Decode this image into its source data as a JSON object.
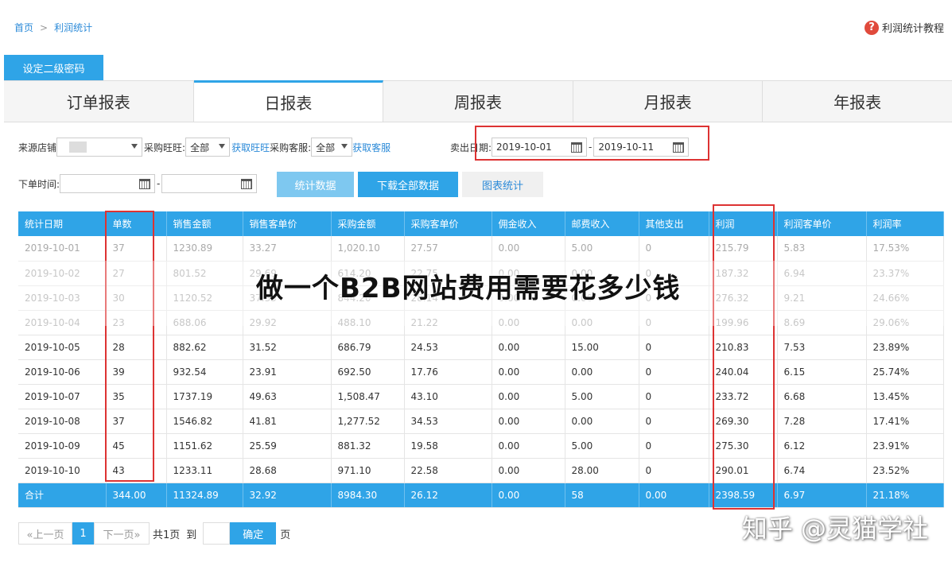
{
  "breadcrumb": {
    "home": "首页",
    "separator": ">",
    "current": "利润统计"
  },
  "help": {
    "icon": "help-icon",
    "label": "利润统计教程",
    "color": "#e04a3c"
  },
  "set_password_label": "设定二级密码",
  "tabs": [
    {
      "label": "订单报表",
      "active": false
    },
    {
      "label": "日报表",
      "active": true
    },
    {
      "label": "周报表",
      "active": false
    },
    {
      "label": "月报表",
      "active": false
    },
    {
      "label": "年报表",
      "active": false
    }
  ],
  "filters": {
    "source_store_label": "来源店铺",
    "purchase_wangwang_label": "采购旺旺:",
    "purchase_wangwang_value": "全部",
    "get_wangwang_link": "获取旺旺",
    "purchase_service_label": "采购客服:",
    "purchase_service_value": "全部",
    "get_service_link": "获取客服",
    "sale_date_label": "卖出日期:",
    "sale_date_from": "2019-10-01",
    "sale_date_to": "2019-10-11",
    "range_separator": "-",
    "order_time_label": "下单时间:"
  },
  "actions": {
    "stats_label": "统计数据",
    "download_label": "下载全部数据",
    "chart_label": "图表统计"
  },
  "table": {
    "headers": [
      "统计日期",
      "单数",
      "销售金额",
      "销售客单价",
      "采购金额",
      "采购客单价",
      "佣金收入",
      "邮费收入",
      "其他支出",
      "利润",
      "利润客单价",
      "利润率"
    ],
    "rows": [
      [
        "2019-10-01",
        "37",
        "1230.89",
        "33.27",
        "1,020.10",
        "27.57",
        "0.00",
        "5.00",
        "0",
        "215.79",
        "5.83",
        "17.53%"
      ],
      [
        "2019-10-02",
        "27",
        "801.52",
        "29.69",
        "614.20",
        "22.75",
        "0.00",
        "0.00",
        "0",
        "187.32",
        "6.94",
        "23.37%"
      ],
      [
        "2019-10-03",
        "30",
        "1120.52",
        "37.35",
        "844.20",
        "28.14",
        "0.00",
        "0.00",
        "0",
        "276.32",
        "9.21",
        "24.66%"
      ],
      [
        "2019-10-04",
        "23",
        "688.06",
        "29.92",
        "488.10",
        "21.22",
        "0.00",
        "0.00",
        "0",
        "199.96",
        "8.69",
        "29.06%"
      ],
      [
        "2019-10-05",
        "28",
        "882.62",
        "31.52",
        "686.79",
        "24.53",
        "0.00",
        "15.00",
        "0",
        "210.83",
        "7.53",
        "23.89%"
      ],
      [
        "2019-10-06",
        "39",
        "932.54",
        "23.91",
        "692.50",
        "17.76",
        "0.00",
        "0.00",
        "0",
        "240.04",
        "6.15",
        "25.74%"
      ],
      [
        "2019-10-07",
        "35",
        "1737.19",
        "49.63",
        "1,508.47",
        "43.10",
        "0.00",
        "5.00",
        "0",
        "233.72",
        "6.68",
        "13.45%"
      ],
      [
        "2019-10-08",
        "37",
        "1546.82",
        "41.81",
        "1,277.52",
        "34.53",
        "0.00",
        "0.00",
        "0",
        "269.30",
        "7.28",
        "17.41%"
      ],
      [
        "2019-10-09",
        "45",
        "1151.62",
        "25.59",
        "881.32",
        "19.58",
        "0.00",
        "5.00",
        "0",
        "275.30",
        "6.12",
        "23.91%"
      ],
      [
        "2019-10-10",
        "43",
        "1233.11",
        "28.68",
        "971.10",
        "22.58",
        "0.00",
        "28.00",
        "0",
        "290.01",
        "6.74",
        "23.52%"
      ]
    ],
    "total": [
      "合计",
      "344.00",
      "11324.89",
      "32.92",
      "8984.30",
      "26.12",
      "0.00",
      "58",
      "0.00",
      "2398.59",
      "6.97",
      "21.18%"
    ]
  },
  "pagination": {
    "prev": "«上一页",
    "current": "1",
    "next": "下一页»",
    "total_pages": "共1页",
    "goto_label": "到",
    "confirm": "确定",
    "page_unit": "页"
  },
  "overlay_title": "做一个B2B网站费用需要花多少钱",
  "watermark": "知乎 @灵猫学社",
  "colors": {
    "accent": "#2fa4e7",
    "highlight_border": "#d33333",
    "link": "#2b8ad8"
  }
}
